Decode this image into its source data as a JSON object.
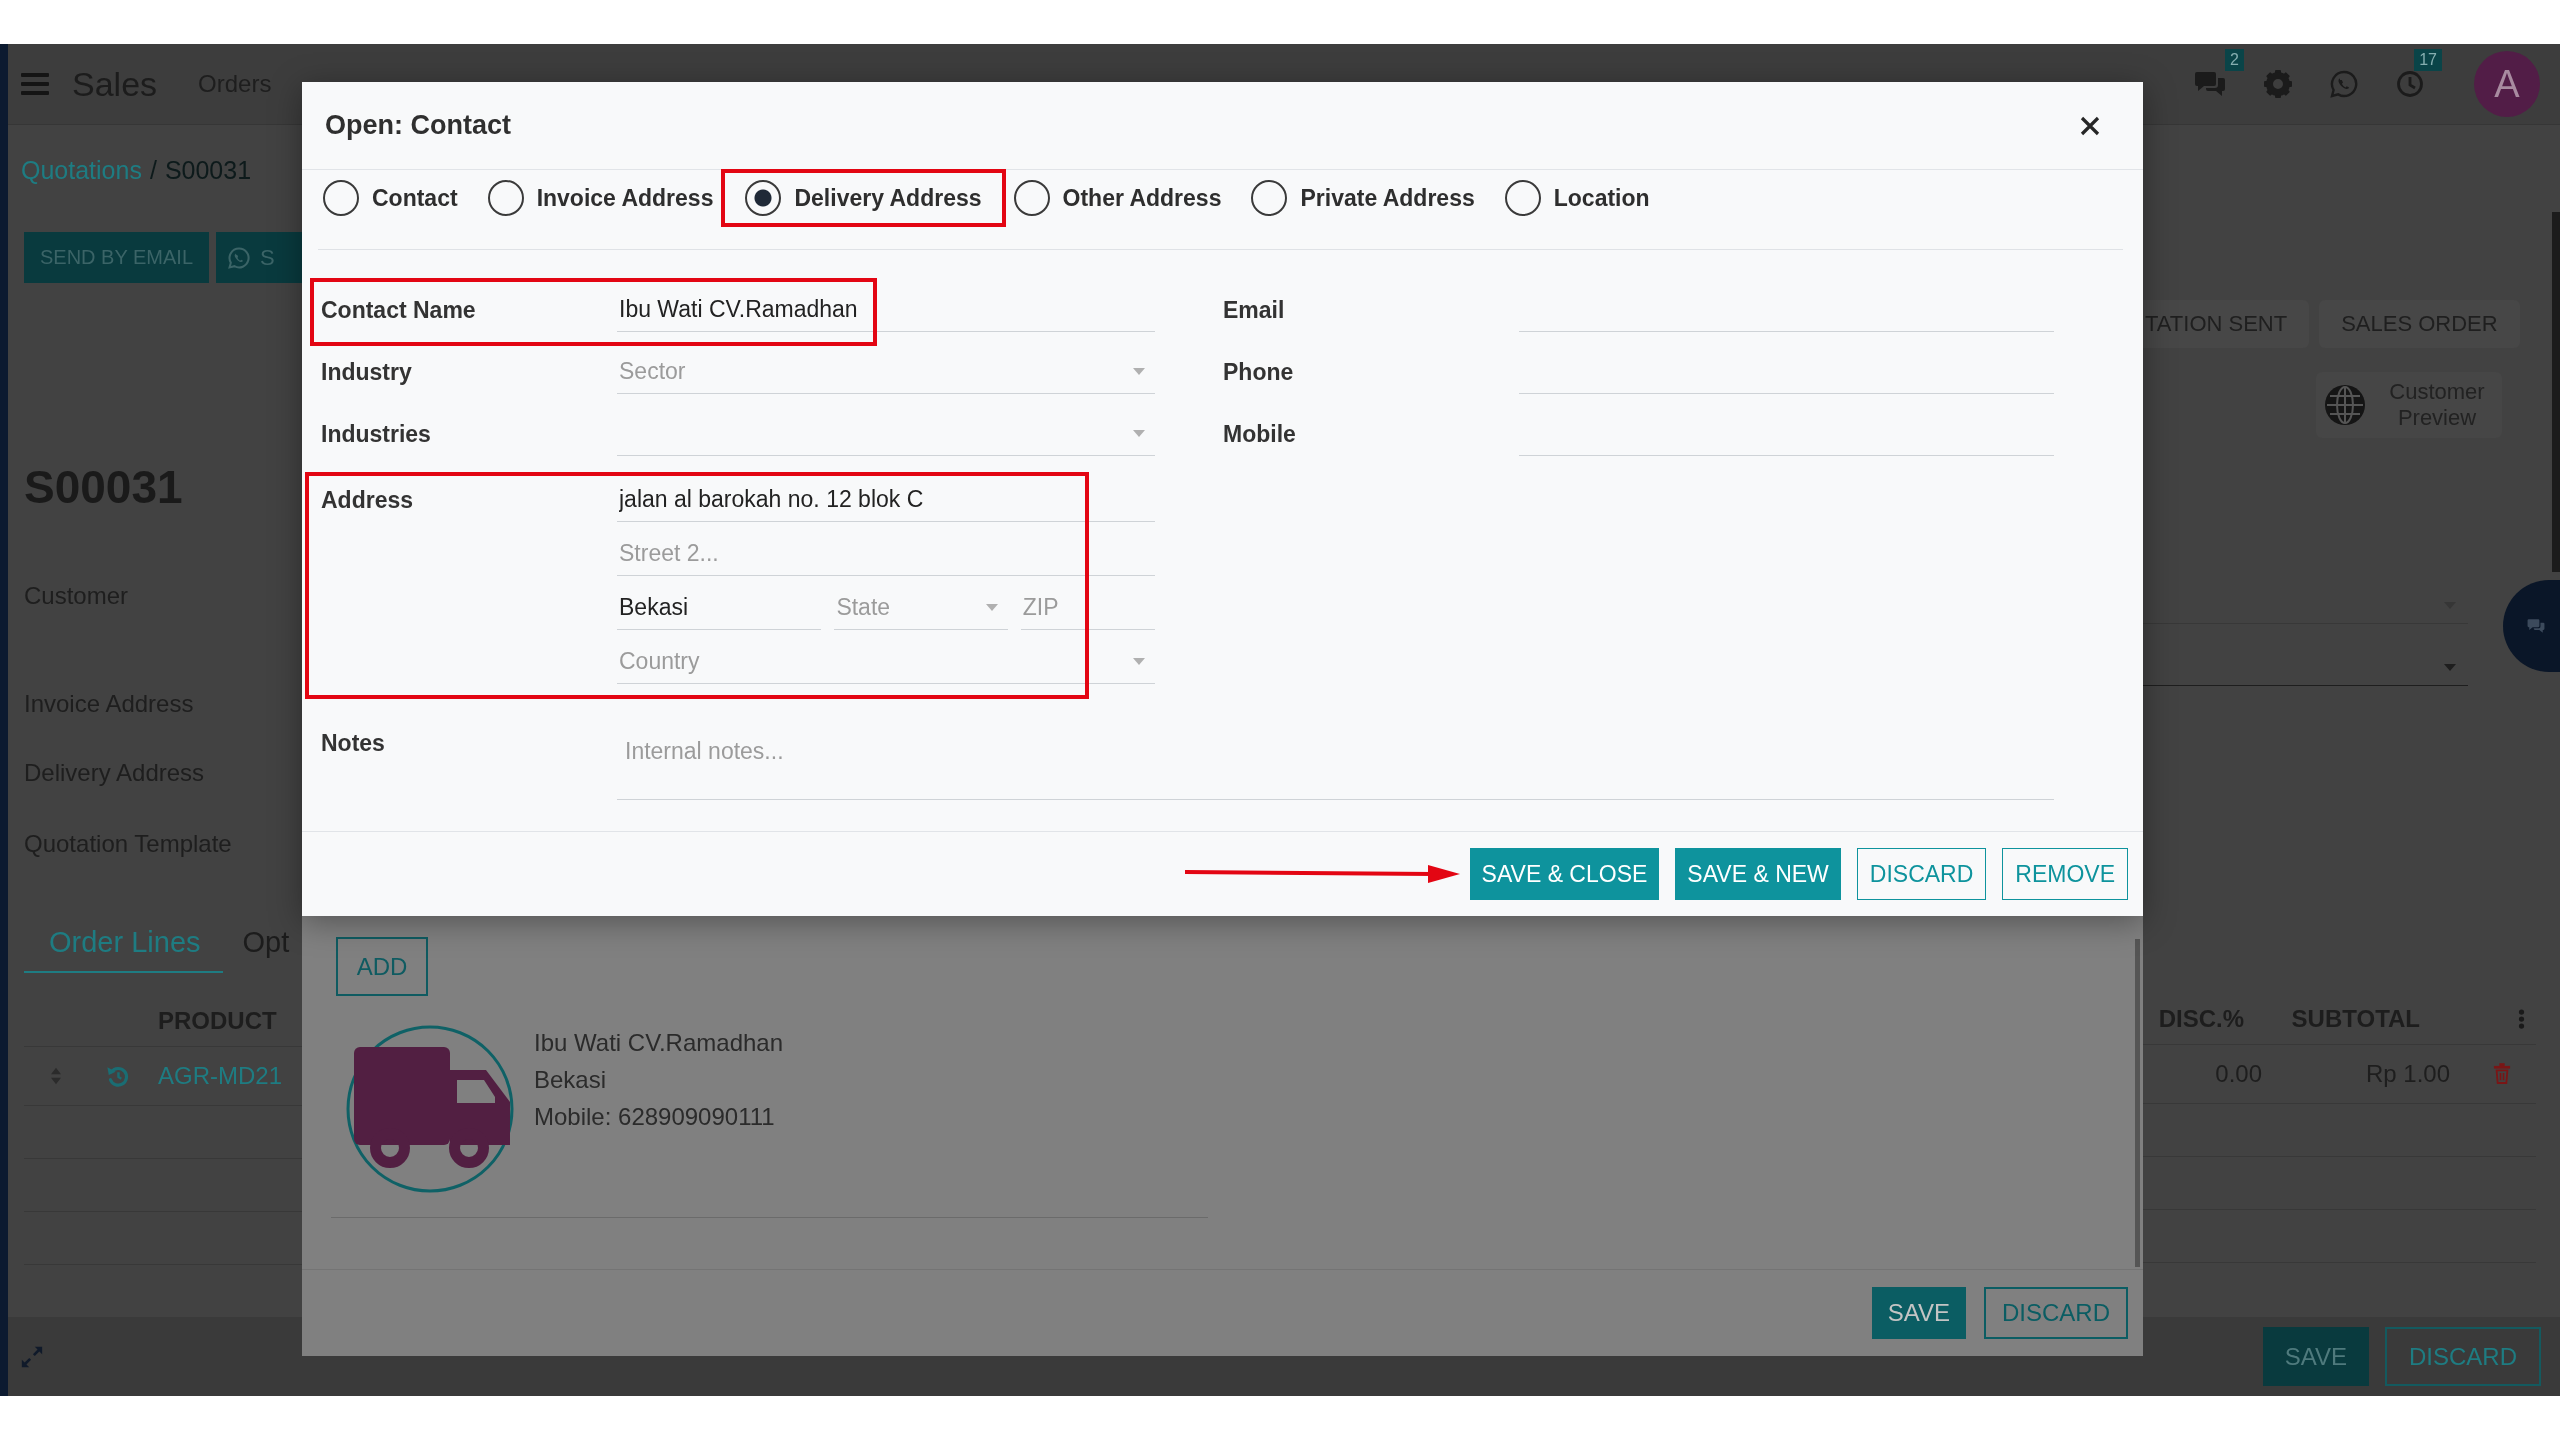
{
  "navbar": {
    "app_name": "Sales",
    "menu": [
      "Orders"
    ],
    "chat_count": "2",
    "activity_count": "17",
    "avatar_initial": "A"
  },
  "breadcrumb": {
    "parent": "Quotations",
    "separator": "/",
    "current": "S00031"
  },
  "header_buttons": [
    {
      "label": "SEND BY EMAIL",
      "kind": "plain"
    },
    {
      "label": "S",
      "kind": "phone_icon"
    }
  ],
  "status_stages": [
    {
      "label": "TATION SENT",
      "selected": false
    },
    {
      "label": "SALES ORDER",
      "selected": false
    }
  ],
  "preview_button": {
    "label": "Customer Preview"
  },
  "record": {
    "name": "S00031",
    "field_labels": [
      "Customer",
      "Invoice Address",
      "Delivery Address",
      "Quotation Template"
    ]
  },
  "tabs": [
    {
      "label": "Order Lines",
      "selected": true
    },
    {
      "label": "Opt",
      "selected": false
    }
  ],
  "order_lines": {
    "columns": [
      "PRODUCT",
      "DISC.%",
      "SUBTOTAL"
    ],
    "rows": [
      {
        "product": "AGR-MD21",
        "discount": "0.00",
        "subtotal": "Rp 1.00"
      }
    ]
  },
  "form_buttons": [
    {
      "label": "SAVE",
      "kind": "primary"
    },
    {
      "label": "DISCARD",
      "kind": "secondary"
    }
  ],
  "address_dialog": {
    "add_button": "ADD",
    "contacts": [
      {
        "name": "Ibu Wati CV.Ramadhan",
        "city": "Bekasi",
        "mobile": "Mobile: 628909090111"
      }
    ],
    "buttons": [
      {
        "label": "SAVE",
        "kind": "primary"
      },
      {
        "label": "DISCARD",
        "kind": "secondary"
      }
    ]
  },
  "contact_dialog": {
    "title": "Open: Contact",
    "address_types": [
      {
        "label": "Contact",
        "selected": false,
        "highlighted": false
      },
      {
        "label": "Invoice Address",
        "selected": false,
        "highlighted": false
      },
      {
        "label": "Delivery Address",
        "selected": true,
        "highlighted": true
      },
      {
        "label": "Other Address",
        "selected": false,
        "highlighted": false
      },
      {
        "label": "Private Address",
        "selected": false,
        "highlighted": false
      },
      {
        "label": "Location",
        "selected": false,
        "highlighted": false
      }
    ],
    "left_fields": [
      {
        "label": "Contact Name",
        "kind": "text",
        "value": "Ibu Wati CV.Ramadhan",
        "highlighted": true
      },
      {
        "label": "Industry",
        "kind": "select",
        "placeholder": "Sector",
        "highlighted": false
      },
      {
        "label": "Industries",
        "kind": "select",
        "highlighted": false
      },
      {
        "label": "Address",
        "kind": "address",
        "highlighted": true,
        "lines": [
          [
            {
              "kind": "text",
              "value": "jalan al barokah no. 12 blok C"
            }
          ],
          [
            {
              "kind": "text",
              "placeholder": "Street 2..."
            }
          ],
          [
            {
              "kind": "text",
              "value": "Bekasi"
            },
            {
              "kind": "select",
              "placeholder": "State"
            },
            {
              "kind": "text",
              "placeholder": "ZIP"
            }
          ],
          [
            {
              "kind": "select",
              "placeholder": "Country"
            }
          ]
        ]
      }
    ],
    "right_fields": [
      {
        "label": "Email",
        "kind": "text"
      },
      {
        "label": "Phone",
        "kind": "text"
      },
      {
        "label": "Mobile",
        "kind": "text"
      }
    ],
    "notes": {
      "label": "Notes",
      "placeholder": "Internal notes..."
    },
    "buttons": [
      {
        "label": "SAVE & CLOSE",
        "kind": "primary",
        "pointed": true
      },
      {
        "label": "SAVE & NEW",
        "kind": "primary",
        "pointed": false
      },
      {
        "label": "DISCARD",
        "kind": "secondary",
        "pointed": false
      },
      {
        "label": "REMOVE",
        "kind": "secondary",
        "pointed": false
      }
    ]
  }
}
